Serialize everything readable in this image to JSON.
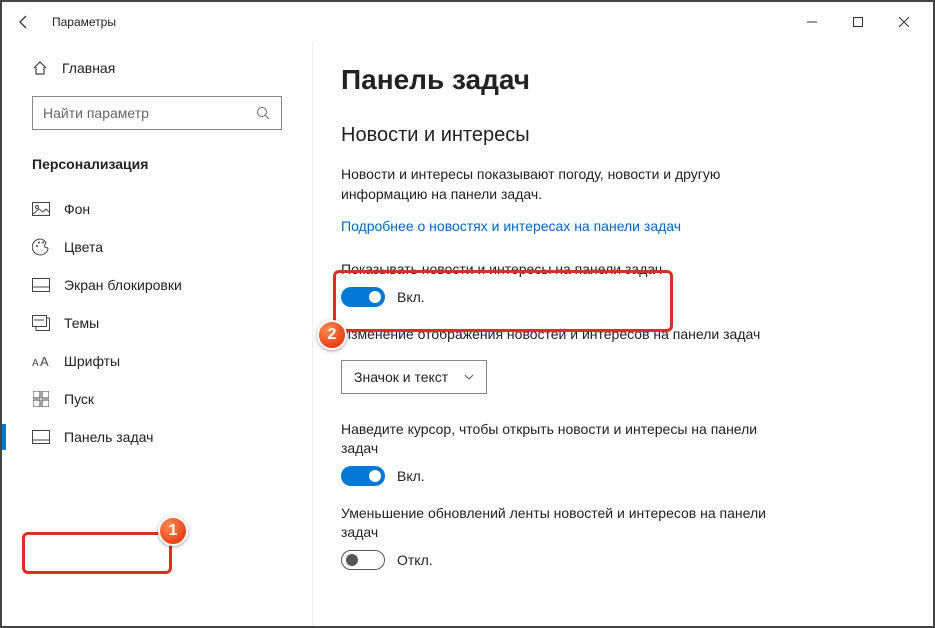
{
  "window": {
    "title": "Параметры"
  },
  "sidebar": {
    "home": "Главная",
    "search_placeholder": "Найти параметр",
    "section": "Персонализация",
    "items": [
      {
        "label": "Фон"
      },
      {
        "label": "Цвета"
      },
      {
        "label": "Экран блокировки"
      },
      {
        "label": "Темы"
      },
      {
        "label": "Шрифты"
      },
      {
        "label": "Пуск"
      },
      {
        "label": "Панель задач"
      }
    ]
  },
  "content": {
    "page_title": "Панель задач",
    "section_title": "Новости и интересы",
    "description": "Новости и интересы показывают погоду, новости и другую информацию на панели задач.",
    "link": "Подробнее о новостях и интересах на панели задач",
    "setting1": {
      "label": "Показывать новости и интересы на панели задач",
      "state": "Вкл."
    },
    "setting2": {
      "label": "Изменение отображения новостей и интересов на панели задач",
      "value": "Значок и текст"
    },
    "setting3": {
      "label": "Наведите курсор, чтобы открыть новости и интересы на панели задач",
      "state": "Вкл."
    },
    "setting4": {
      "label": "Уменьшение обновлений ленты новостей и интересов на панели задач",
      "state": "Откл."
    }
  },
  "annotations": {
    "b1": "1",
    "b2": "2"
  }
}
